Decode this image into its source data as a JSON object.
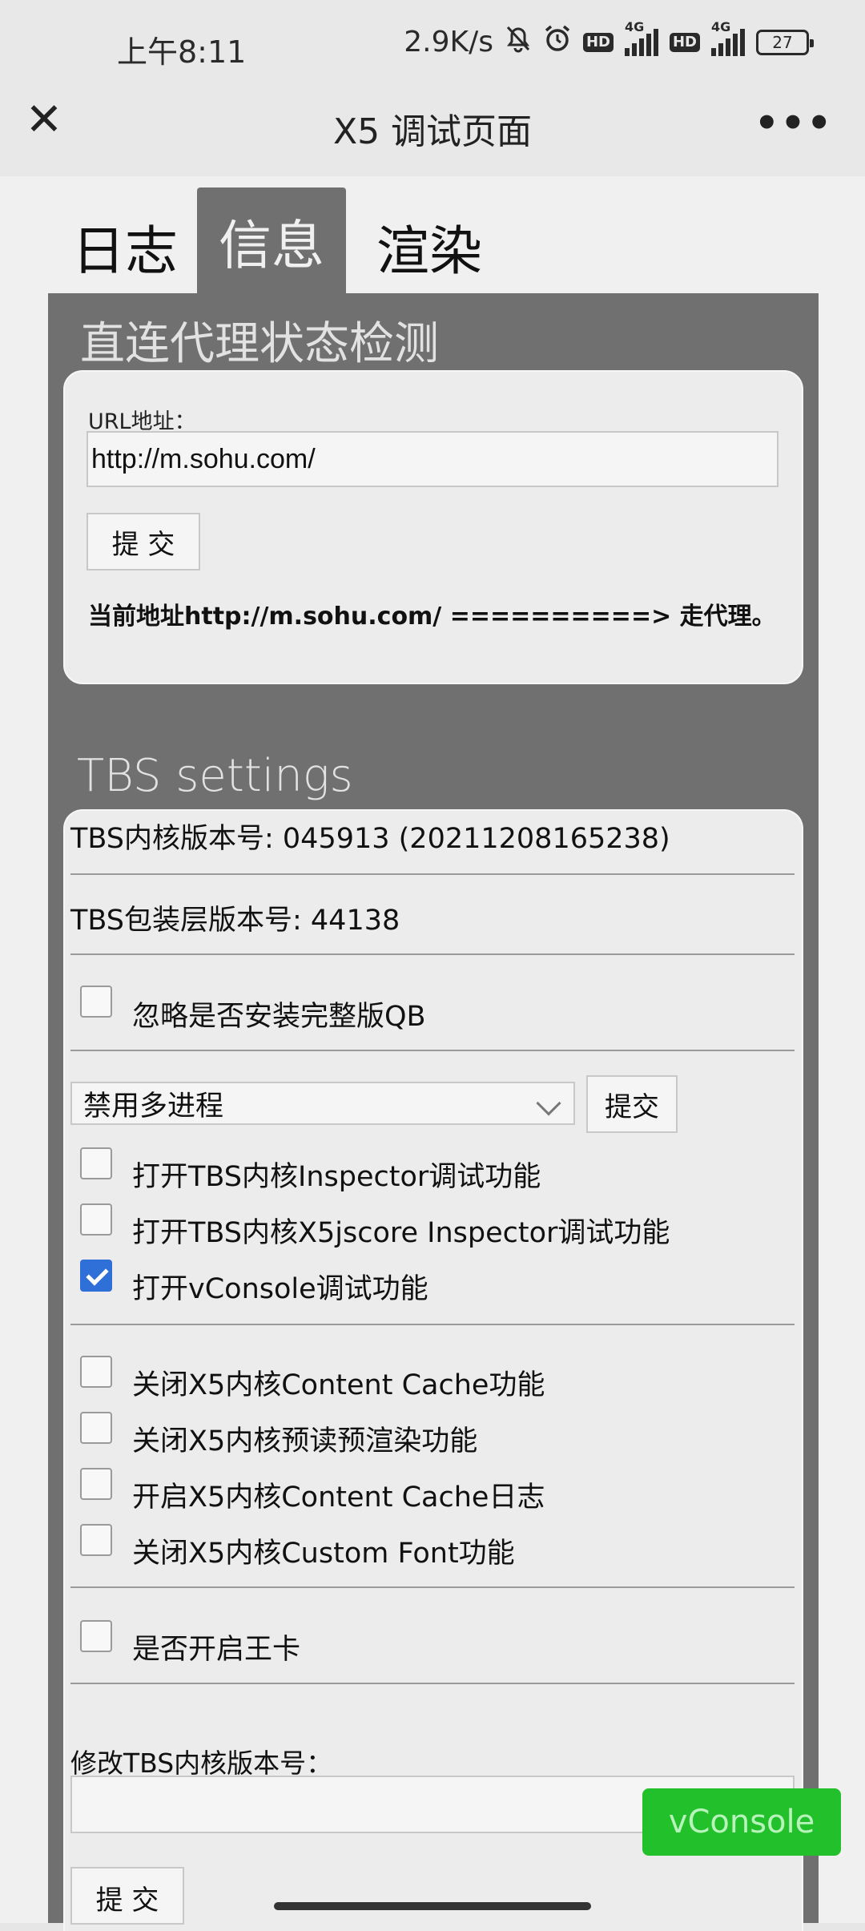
{
  "status_bar": {
    "time": "上午8:11",
    "speed": "2.9K/s",
    "hd_label": "HD",
    "network_label": "4G",
    "battery": "27"
  },
  "title_bar": {
    "title": "X5 调试页面",
    "close_icon": "close-icon",
    "more_icon": "more-icon"
  },
  "tabs": [
    "日志",
    "信息",
    "渲染"
  ],
  "proxy_section": {
    "title": "直连代理状态检测",
    "url_label": "URL地址：",
    "url_value": "http://m.sohu.com/",
    "submit_label": "提 交",
    "result_text": "当前地址http://m.sohu.com/ ==========> 走代理。"
  },
  "tbs_section": {
    "title": "TBS settings",
    "core_version": "TBS内核版本号: 045913 (20211208165238)",
    "wrapper_version": "TBS包装层版本号: 44138",
    "ignore_qb": {
      "label": "忽略是否安装完整版QB",
      "checked": false
    },
    "process_select": {
      "value": "禁用多进程",
      "submit_label": "提交"
    },
    "debug_options": [
      {
        "label": "打开TBS内核Inspector调试功能",
        "checked": false
      },
      {
        "label": "打开TBS内核X5jscore Inspector调试功能",
        "checked": false
      },
      {
        "label": "打开vConsole调试功能",
        "checked": true
      }
    ],
    "cache_options": [
      {
        "label": "关闭X5内核Content Cache功能",
        "checked": false
      },
      {
        "label": "关闭X5内核预读预渲染功能",
        "checked": false
      },
      {
        "label": "开启X5内核Content Cache日志",
        "checked": false
      },
      {
        "label": "关闭X5内核Custom Font功能",
        "checked": false
      }
    ],
    "wangka": {
      "label": "是否开启王卡",
      "checked": false
    },
    "modify_version_label": "修改TBS内核版本号：",
    "modify_version_value": "",
    "modify_submit_label": "提 交"
  },
  "vconsole_button": "vConsole"
}
